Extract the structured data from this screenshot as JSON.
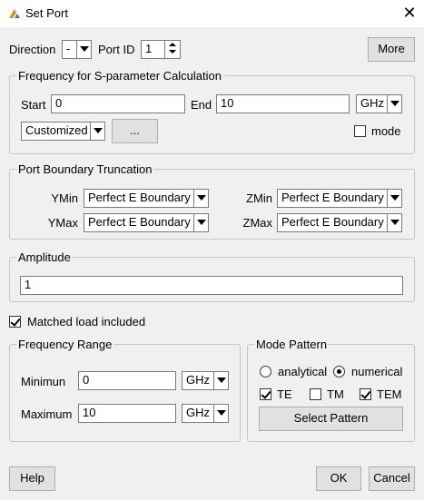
{
  "window": {
    "title": "Set Port",
    "close_glyph": "✕",
    "app_icon": "app-logo-icon"
  },
  "top": {
    "direction_label": "Direction",
    "direction_value": "-",
    "port_id_label": "Port ID",
    "port_id_value": "1",
    "more_button": "More"
  },
  "frequency_sparam": {
    "legend": "Frequency for S-parameter Calculation",
    "start_label": "Start",
    "start_value": "0",
    "end_label": "End",
    "end_value": "10",
    "unit": "GHz",
    "type_value": "Customized",
    "browse_button": "...",
    "mode_label": "mode",
    "mode_checked": false
  },
  "boundary": {
    "legend": "Port Boundary Truncation",
    "ymin_label": "YMin",
    "ymin_value": "Perfect E Boundary",
    "ymax_label": "YMax",
    "ymax_value": "Perfect E Boundary",
    "zmin_label": "ZMin",
    "zmin_value": "Perfect E Boundary",
    "zmax_label": "ZMax",
    "zmax_value": "Perfect E Boundary"
  },
  "amplitude": {
    "legend": "Amplitude",
    "value": "1"
  },
  "matched_load": {
    "label": "Matched load included",
    "checked": true
  },
  "frequency_range": {
    "legend": "Frequency Range",
    "min_label": "Minimun",
    "min_value": "0",
    "min_unit": "GHz",
    "max_label": "Maximum",
    "max_value": "10",
    "max_unit": "GHz"
  },
  "mode_pattern": {
    "legend": "Mode Pattern",
    "analytical_label": "analytical",
    "numerical_label": "numerical",
    "selected": "numerical",
    "te_label": "TE",
    "te_checked": true,
    "tm_label": "TM",
    "tm_checked": false,
    "tem_label": "TEM",
    "tem_checked": true,
    "select_button": "Select Pattern"
  },
  "footer": {
    "help_button": "Help",
    "ok_button": "OK",
    "cancel_button": "Cancel"
  },
  "colors": {
    "window_bg": "#f0f0f0",
    "titlebar_bg": "#ffffff",
    "group_border": "#c6c6c6",
    "button_bg": "#e1e1e1"
  }
}
